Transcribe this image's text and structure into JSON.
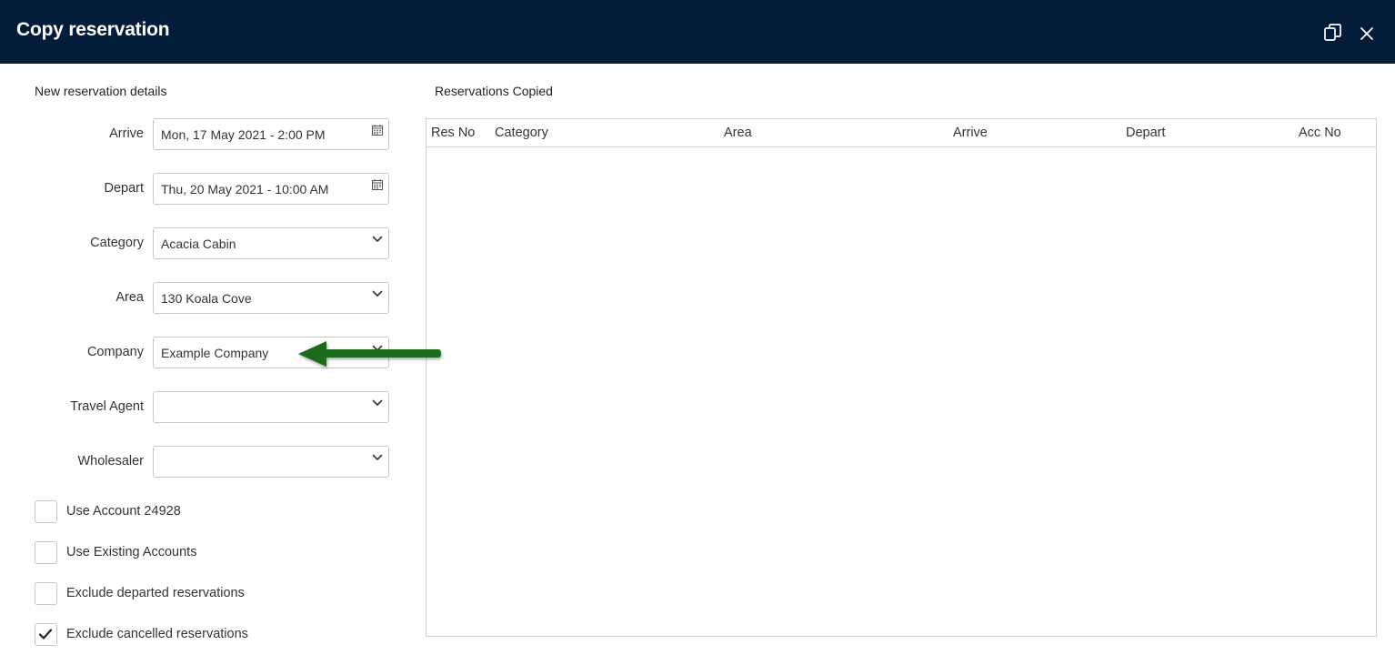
{
  "window": {
    "title": "Copy reservation",
    "icons": [
      "duplicate-window-icon",
      "close-icon"
    ]
  },
  "form": {
    "section_title": "New reservation details",
    "fields": [
      {
        "label": "Arrive",
        "value": "Mon, 17 May 2021 - 2:00 PM",
        "icon": "calendar-icon"
      },
      {
        "label": "Depart",
        "value": "Thu, 20 May 2021 - 10:00 AM",
        "icon": "calendar-icon"
      },
      {
        "label": "Category",
        "value": "Acacia Cabin",
        "icon": "chevron-down-icon"
      },
      {
        "label": "Area",
        "value": "130 Koala Cove",
        "icon": "chevron-down-icon"
      },
      {
        "label": "Company",
        "value": "Example Company",
        "icon": "chevron-down-icon"
      },
      {
        "label": "Travel Agent",
        "value": "",
        "icon": "chevron-down-icon"
      },
      {
        "label": "Wholesaler",
        "value": "",
        "icon": "chevron-down-icon"
      }
    ],
    "checkboxes": [
      {
        "label": "Use Account 24928",
        "checked": false
      },
      {
        "label": "Use Existing Accounts",
        "checked": false
      },
      {
        "label": "Exclude departed reservations",
        "checked": false
      },
      {
        "label": "Exclude cancelled reservations",
        "checked": true
      }
    ]
  },
  "copied": {
    "section_title": "Reservations Copied",
    "columns": [
      "Res No",
      "Category",
      "Area",
      "Arrive",
      "Depart",
      "Acc No"
    ],
    "rows": []
  },
  "annotation": {
    "color": "#1e6b1e",
    "icon": "green-arrow-pointer"
  },
  "colors": {
    "titlebar": "#031c3a"
  }
}
